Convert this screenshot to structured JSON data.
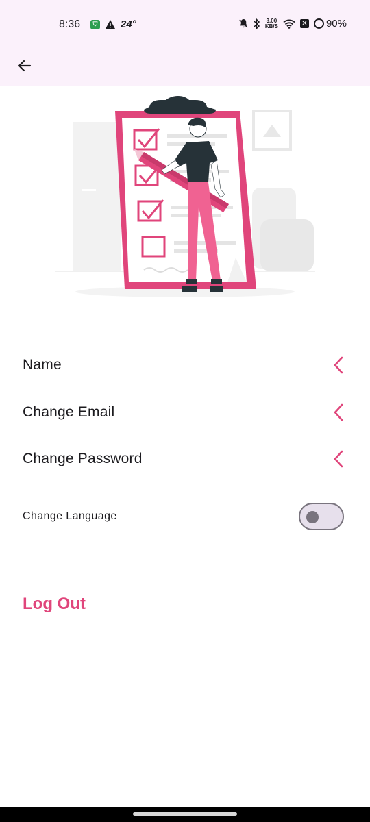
{
  "status_bar": {
    "time": "8:36",
    "temperature": "24°",
    "network_speed_value": "3.00",
    "network_speed_unit": "KB/S",
    "battery": "90%"
  },
  "app_bar": {
    "back_icon": "arrow-back-icon"
  },
  "illustration": {
    "icon": "checklist-illustration",
    "accent_color": "#e0457b"
  },
  "menu": {
    "items": [
      {
        "label": "Name",
        "icon": "chevron-left-icon"
      },
      {
        "label": "Change Email",
        "icon": "chevron-left-icon"
      },
      {
        "label": "Change Password",
        "icon": "chevron-left-icon"
      }
    ],
    "language": {
      "label": "Change Language",
      "toggle_on": false
    }
  },
  "logout": {
    "label": "Log Out"
  },
  "colors": {
    "accent": "#e0457b",
    "app_bar_bg": "#fbf1fb"
  }
}
